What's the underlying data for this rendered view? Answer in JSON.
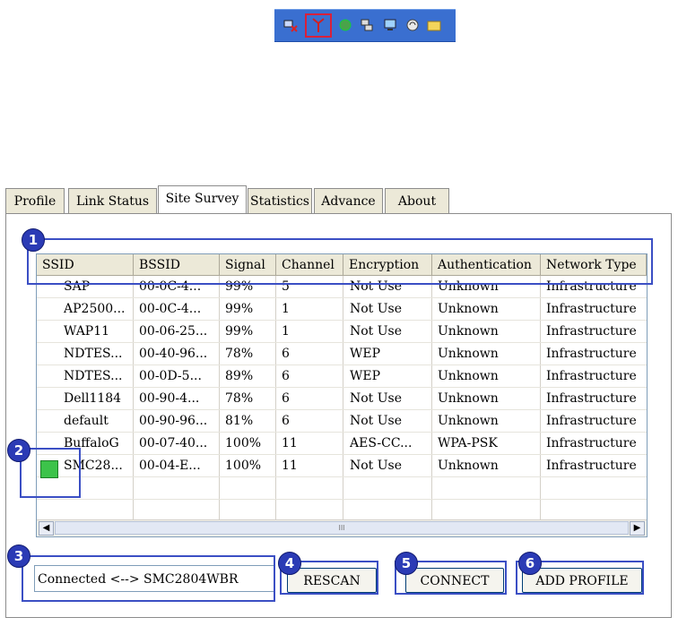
{
  "tray_icons": [
    "network-icon",
    "antenna-icon",
    "globe-icon",
    "network-cable-icon",
    "monitor-icon",
    "speaker-icon",
    "folder-icon"
  ],
  "tabs": [
    {
      "label": "Profile"
    },
    {
      "label": "Link Status"
    },
    {
      "label": "Site Survey"
    },
    {
      "label": "Statistics"
    },
    {
      "label": "Advance"
    },
    {
      "label": "About"
    }
  ],
  "columns": [
    "SSID",
    "BSSID",
    "Signal",
    "Channel",
    "Encryption",
    "Authentication",
    "Network Type"
  ],
  "rows": [
    {
      "ssid": "SAP",
      "bssid": "00-0C-4...",
      "signal": "99%",
      "channel": "5",
      "encryption": "Not Use",
      "auth": "Unknown",
      "type": "Infrastructure"
    },
    {
      "ssid": "AP2500...",
      "bssid": "00-0C-4...",
      "signal": "99%",
      "channel": "1",
      "encryption": "Not Use",
      "auth": "Unknown",
      "type": "Infrastructure"
    },
    {
      "ssid": "WAP11",
      "bssid": "00-06-25...",
      "signal": "99%",
      "channel": "1",
      "encryption": "Not Use",
      "auth": "Unknown",
      "type": "Infrastructure"
    },
    {
      "ssid": "NDTES...",
      "bssid": "00-40-96...",
      "signal": "78%",
      "channel": "6",
      "encryption": "WEP",
      "auth": "Unknown",
      "type": "Infrastructure"
    },
    {
      "ssid": "NDTES...",
      "bssid": "00-0D-5...",
      "signal": "89%",
      "channel": "6",
      "encryption": "WEP",
      "auth": "Unknown",
      "type": "Infrastructure"
    },
    {
      "ssid": "Dell1184",
      "bssid": "00-90-4...",
      "signal": "78%",
      "channel": "6",
      "encryption": "Not Use",
      "auth": "Unknown",
      "type": "Infrastructure"
    },
    {
      "ssid": "default",
      "bssid": "00-90-96...",
      "signal": "81%",
      "channel": "6",
      "encryption": "Not Use",
      "auth": "Unknown",
      "type": "Infrastructure"
    },
    {
      "ssid": "BuffaloG",
      "bssid": "00-07-40...",
      "signal": "100%",
      "channel": "11",
      "encryption": "AES-CC...",
      "auth": "WPA-PSK",
      "type": "Infrastructure"
    },
    {
      "ssid": "SMC28...",
      "bssid": "00-04-E...",
      "signal": "100%",
      "channel": "11",
      "encryption": "Not Use",
      "auth": "Unknown",
      "type": "Infrastructure"
    }
  ],
  "scroll_mid_glyph": "III",
  "status_text": "Connected <--> SMC2804WBR",
  "buttons": {
    "rescan": "RESCAN",
    "connect": "CONNECT",
    "add_profile": "ADD PROFILE"
  },
  "callouts": [
    "1",
    "2",
    "3",
    "4",
    "5",
    "6"
  ],
  "colors": {
    "taskbar": "#3a6fd0",
    "callout": "#2b3bb5",
    "highlight": "#d9203a",
    "connected_icon": "#3cc34a"
  }
}
